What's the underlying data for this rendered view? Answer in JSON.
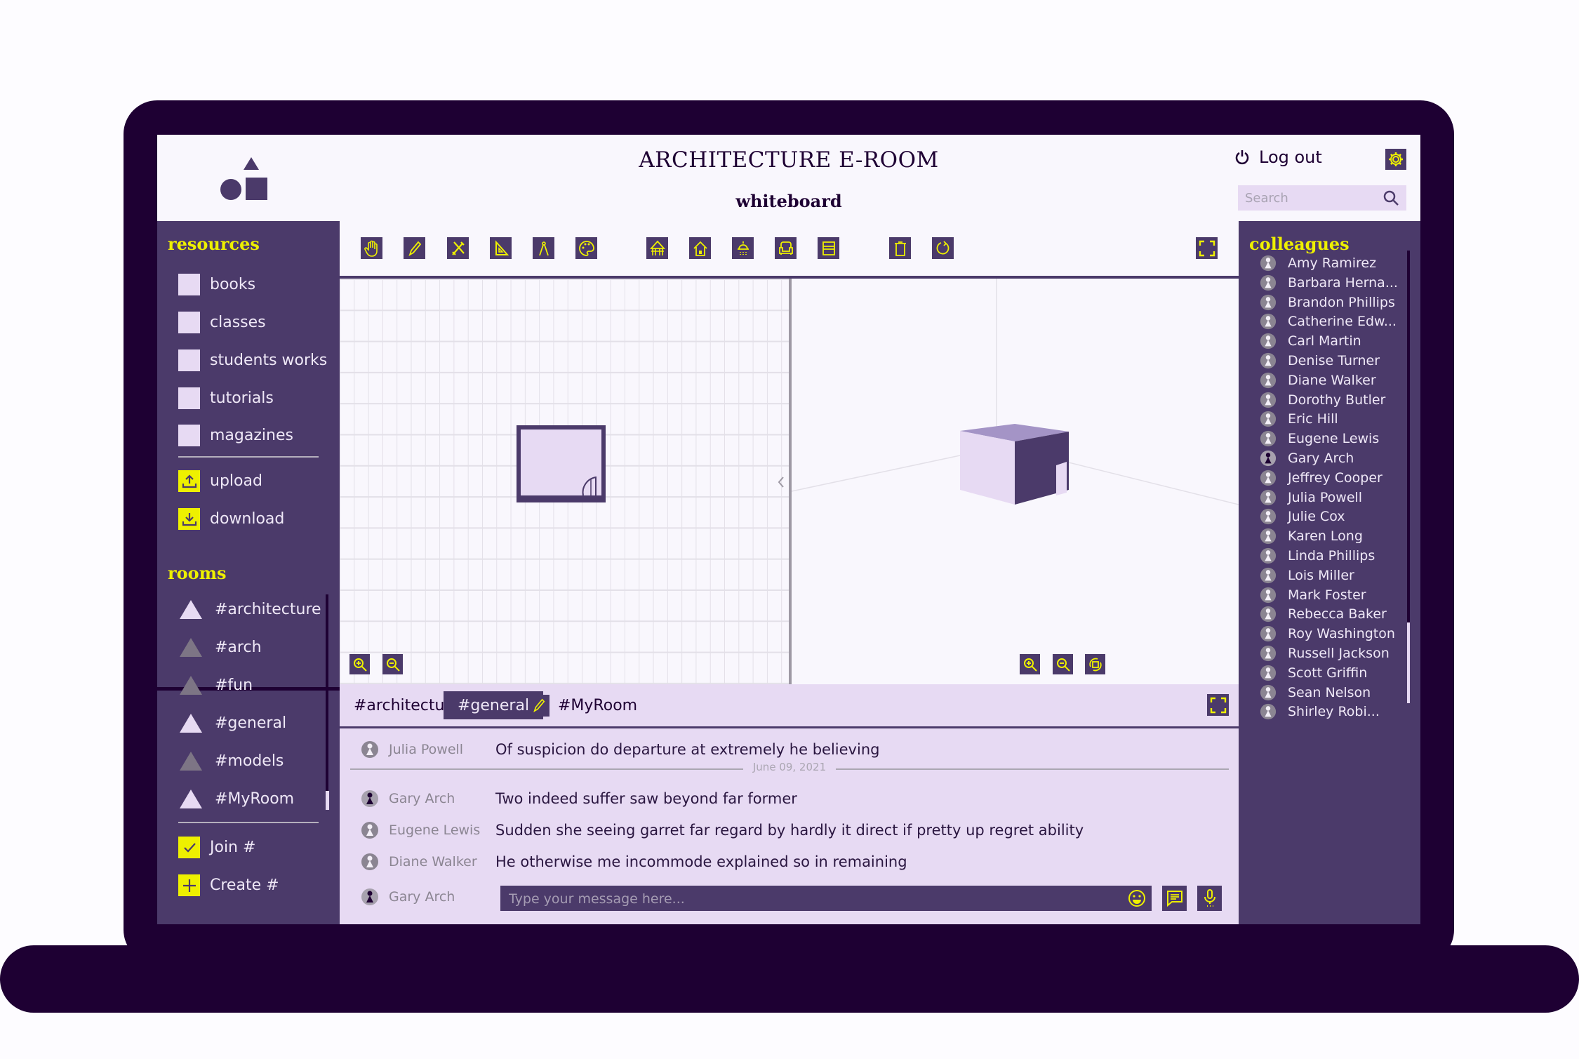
{
  "header": {
    "title": "ARCHITECTURE E-ROOM",
    "subtitle": "whiteboard",
    "logout_label": "Log out",
    "search_placeholder": "Search"
  },
  "resources": {
    "title": "resources",
    "items": [
      {
        "label": "books"
      },
      {
        "label": "classes"
      },
      {
        "label": "students works"
      },
      {
        "label": "tutorials"
      },
      {
        "label": "magazines"
      }
    ],
    "actions": [
      {
        "label": "upload",
        "icon": "upload-icon"
      },
      {
        "label": "download",
        "icon": "download-icon"
      }
    ]
  },
  "rooms": {
    "title": "rooms",
    "items": [
      {
        "label": "#architecture",
        "active": true
      },
      {
        "label": "#arch",
        "active": false
      },
      {
        "label": "#fun",
        "active": false
      },
      {
        "label": "#general",
        "active": true
      },
      {
        "label": "#models",
        "active": false
      },
      {
        "label": "#MyRoom",
        "active": true
      }
    ],
    "actions": [
      {
        "label": "Join #",
        "icon": "check-icon"
      },
      {
        "label": "Create #",
        "icon": "plus-icon"
      }
    ]
  },
  "toolbar": {
    "tools": [
      "hand-icon",
      "pencil-icon",
      "tools-icon",
      "set-square-icon",
      "compass-icon",
      "palette-icon",
      "facade-icon",
      "house-icon",
      "lamp-icon",
      "armchair-icon",
      "bed-icon",
      "trash-icon",
      "rotate-icon"
    ],
    "fullscreen_icon": "fullscreen-icon"
  },
  "chat": {
    "tabs": [
      {
        "label": "#architecture",
        "active": false
      },
      {
        "label": "#general",
        "active": true
      },
      {
        "label": "#MyRoom",
        "active": false,
        "icon": "pencil-icon"
      }
    ],
    "messages": [
      {
        "author": "Julia Powell",
        "text": "Of suspicion do departure at extremely he believing"
      },
      {
        "author": "Gary Arch",
        "text": "Two indeed suffer saw beyond far former",
        "self": true
      },
      {
        "author": "Eugene Lewis",
        "text": "Sudden she seeing garret far regard by hardly it direct if pretty up regret ability"
      },
      {
        "author": "Diane Walker",
        "text": "He otherwise me incommode explained so in remaining"
      }
    ],
    "date_separator": "June 09, 2021",
    "composer": {
      "author": "Gary Arch",
      "placeholder": "Type your message here..."
    }
  },
  "colleagues": {
    "title": "colleagues",
    "items": [
      "Amy Ramirez",
      "Barbara Herna...",
      "Brandon Phillips",
      "Catherine Edw...",
      "Carl Martin",
      "Denise Turner",
      "Diane Walker",
      "Dorothy Butler",
      "Eric Hill",
      "Eugene Lewis",
      "Gary Arch",
      "Jeffrey Cooper",
      "Julia Powell",
      "Julie Cox",
      "Karen Long",
      "Linda Phillips",
      "Lois Miller",
      "Mark Foster",
      "Rebecca Baker",
      "Roy Washington",
      "Russell Jackson",
      "Scott Griffin",
      "Sean Nelson",
      "Shirley Robi..."
    ],
    "self": "Gary Arch"
  },
  "colors": {
    "frame": "#1e0033",
    "panel": "#4b3a6a",
    "accent": "#eef000",
    "light": "#e7daf3",
    "background": "#f9f7fd"
  }
}
